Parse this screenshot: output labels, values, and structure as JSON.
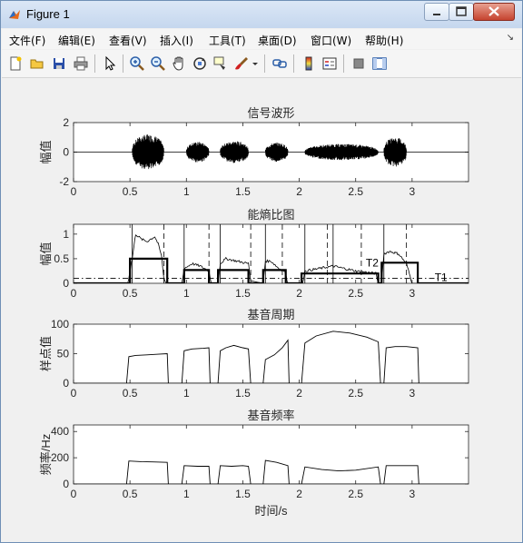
{
  "window": {
    "title": "Figure 1"
  },
  "menu": {
    "items": [
      "文件(F)",
      "编辑(E)",
      "查看(V)",
      "插入(I)",
      "工具(T)",
      "桌面(D)",
      "窗口(W)",
      "帮助(H)"
    ]
  },
  "toolbar": {
    "icons": [
      "new-figure-icon",
      "open-file-icon",
      "save-icon",
      "print-icon",
      "select-arrow-icon",
      "zoom-in-icon",
      "zoom-out-icon",
      "pan-hand-icon",
      "rotate-3d-icon",
      "data-cursor-icon",
      "brush-icon",
      "brush-dropdown-icon",
      "link-plot-icon",
      "colorbar-icon",
      "legend-icon",
      "hide-plot-tools-icon",
      "show-plot-tools-icon"
    ]
  },
  "colors": {
    "line": "#000000",
    "axes_bg": "#ffffff",
    "figure_bg": "#f0f0f0"
  },
  "chart_data": [
    {
      "type": "line",
      "title": "信号波形",
      "xlabel": "",
      "ylabel": "幅值",
      "xlim": [
        0,
        3.5
      ],
      "ylim": [
        -2,
        2
      ],
      "xticks": [
        "0",
        "0.5",
        "1",
        "1.5",
        "2",
        "2.5",
        "3"
      ],
      "yticks": [
        "-2",
        "0",
        "2"
      ],
      "segments": [
        {
          "start": 0.52,
          "end": 0.8,
          "amp": 1.2
        },
        {
          "start": 1.0,
          "end": 1.2,
          "amp": 0.7
        },
        {
          "start": 1.3,
          "end": 1.55,
          "amp": 0.75
        },
        {
          "start": 1.7,
          "end": 1.9,
          "amp": 0.65
        },
        {
          "start": 2.05,
          "end": 2.7,
          "amp": 0.55
        },
        {
          "start": 2.75,
          "end": 2.95,
          "amp": 1.0
        }
      ]
    },
    {
      "type": "line",
      "title": "能熵比图",
      "xlabel": "",
      "ylabel": "幅值",
      "xlim": [
        0,
        3.5
      ],
      "ylim": [
        0,
        1.2
      ],
      "xticks": [
        "0",
        "0.5",
        "1",
        "1.5",
        "2",
        "2.5",
        "3"
      ],
      "yticks": [
        "0",
        "0.5",
        "1"
      ],
      "annotations": [
        "T2",
        "T1"
      ],
      "threshold_T1": 0.1,
      "threshold_T2": 0.4,
      "solid_markers": [
        0.52,
        0.98,
        1.3,
        1.7,
        2.05,
        2.3,
        2.75
      ],
      "dashed_markers": [
        0.8,
        1.2,
        1.57,
        1.85,
        2.25,
        2.55,
        2.95
      ],
      "curve": [
        [
          0,
          0
        ],
        [
          0.48,
          0
        ],
        [
          0.52,
          0.5
        ],
        [
          0.55,
          1.0
        ],
        [
          0.6,
          0.9
        ],
        [
          0.65,
          0.85
        ],
        [
          0.72,
          0.95
        ],
        [
          0.75,
          0.8
        ],
        [
          0.78,
          0.55
        ],
        [
          0.8,
          0.1
        ],
        [
          0.82,
          0
        ],
        [
          0.96,
          0
        ],
        [
          0.98,
          0.3
        ],
        [
          1.05,
          0.4
        ],
        [
          1.12,
          0.35
        ],
        [
          1.2,
          0.25
        ],
        [
          1.22,
          0
        ],
        [
          1.28,
          0
        ],
        [
          1.3,
          0.4
        ],
        [
          1.35,
          0.5
        ],
        [
          1.45,
          0.45
        ],
        [
          1.55,
          0.4
        ],
        [
          1.57,
          0.05
        ],
        [
          1.68,
          0
        ],
        [
          1.7,
          0.45
        ],
        [
          1.75,
          0.45
        ],
        [
          1.82,
          0.3
        ],
        [
          1.87,
          0.25
        ],
        [
          1.9,
          0
        ],
        [
          2.03,
          0
        ],
        [
          2.05,
          0.25
        ],
        [
          2.3,
          0.35
        ],
        [
          2.5,
          0.25
        ],
        [
          2.68,
          0.2
        ],
        [
          2.7,
          0
        ],
        [
          2.73,
          0
        ],
        [
          2.75,
          0.6
        ],
        [
          2.8,
          0.65
        ],
        [
          2.88,
          0.6
        ],
        [
          2.95,
          0.4
        ],
        [
          3.0,
          0
        ],
        [
          3.5,
          0
        ]
      ],
      "step": [
        [
          0,
          0
        ],
        [
          0.5,
          0
        ],
        [
          0.5,
          0.5
        ],
        [
          0.83,
          0.5
        ],
        [
          0.83,
          0
        ],
        [
          0.98,
          0
        ],
        [
          0.98,
          0.27
        ],
        [
          1.2,
          0.27
        ],
        [
          1.2,
          0
        ],
        [
          1.28,
          0
        ],
        [
          1.28,
          0.27
        ],
        [
          1.55,
          0.27
        ],
        [
          1.55,
          0
        ],
        [
          1.68,
          0
        ],
        [
          1.68,
          0.27
        ],
        [
          1.88,
          0.27
        ],
        [
          1.88,
          0
        ],
        [
          2.02,
          0
        ],
        [
          2.02,
          0.2
        ],
        [
          2.7,
          0.2
        ],
        [
          2.7,
          0
        ],
        [
          2.73,
          0
        ],
        [
          2.73,
          0.42
        ],
        [
          3.05,
          0.42
        ],
        [
          3.05,
          0
        ],
        [
          3.5,
          0
        ]
      ]
    },
    {
      "type": "line",
      "title": "基音周期",
      "xlabel": "",
      "ylabel": "样点值",
      "xlim": [
        0,
        3.5
      ],
      "ylim": [
        0,
        100
      ],
      "xticks": [
        "0",
        "0.5",
        "1",
        "1.5",
        "2",
        "2.5",
        "3"
      ],
      "yticks": [
        "0",
        "50",
        "100"
      ],
      "segments": [
        [
          [
            0.47,
            0
          ],
          [
            0.49,
            45
          ],
          [
            0.55,
            47
          ],
          [
            0.65,
            48
          ],
          [
            0.75,
            49
          ],
          [
            0.83,
            50
          ],
          [
            0.84,
            0
          ]
        ],
        [
          [
            0.96,
            0
          ],
          [
            0.98,
            55
          ],
          [
            1.05,
            58
          ],
          [
            1.15,
            59
          ],
          [
            1.2,
            60
          ],
          [
            1.21,
            0
          ]
        ],
        [
          [
            1.28,
            0
          ],
          [
            1.3,
            55
          ],
          [
            1.35,
            60
          ],
          [
            1.42,
            64
          ],
          [
            1.5,
            60
          ],
          [
            1.55,
            58
          ],
          [
            1.57,
            0
          ]
        ],
        [
          [
            1.68,
            0
          ],
          [
            1.7,
            40
          ],
          [
            1.78,
            48
          ],
          [
            1.85,
            60
          ],
          [
            1.9,
            73
          ],
          [
            1.91,
            0
          ]
        ],
        [
          [
            2.02,
            0
          ],
          [
            2.05,
            68
          ],
          [
            2.15,
            80
          ],
          [
            2.3,
            88
          ],
          [
            2.45,
            85
          ],
          [
            2.6,
            78
          ],
          [
            2.7,
            70
          ],
          [
            2.72,
            0
          ]
        ],
        [
          [
            2.75,
            0
          ],
          [
            2.77,
            60
          ],
          [
            2.85,
            62
          ],
          [
            2.95,
            62
          ],
          [
            3.05,
            60
          ],
          [
            3.06,
            0
          ]
        ]
      ]
    },
    {
      "type": "line",
      "title": "基音频率",
      "xlabel": "时间/s",
      "ylabel": "频率/Hz",
      "xlim": [
        0,
        3.5
      ],
      "ylim": [
        0,
        450
      ],
      "xticks": [
        "0",
        "0.5",
        "1",
        "1.5",
        "2",
        "2.5",
        "3"
      ],
      "yticks": [
        "0",
        "200",
        "400"
      ],
      "segments": [
        [
          [
            0.47,
            0
          ],
          [
            0.49,
            175
          ],
          [
            0.6,
            170
          ],
          [
            0.7,
            168
          ],
          [
            0.83,
            165
          ],
          [
            0.84,
            0
          ]
        ],
        [
          [
            0.96,
            0
          ],
          [
            0.98,
            140
          ],
          [
            1.1,
            135
          ],
          [
            1.2,
            135
          ],
          [
            1.21,
            0
          ]
        ],
        [
          [
            1.28,
            0
          ],
          [
            1.3,
            140
          ],
          [
            1.4,
            135
          ],
          [
            1.5,
            140
          ],
          [
            1.55,
            135
          ],
          [
            1.57,
            0
          ]
        ],
        [
          [
            1.68,
            0
          ],
          [
            1.7,
            180
          ],
          [
            1.8,
            165
          ],
          [
            1.9,
            140
          ],
          [
            1.91,
            0
          ]
        ],
        [
          [
            2.02,
            0
          ],
          [
            2.05,
            130
          ],
          [
            2.2,
            110
          ],
          [
            2.35,
            100
          ],
          [
            2.5,
            105
          ],
          [
            2.7,
            130
          ],
          [
            2.72,
            0
          ]
        ],
        [
          [
            2.75,
            0
          ],
          [
            2.77,
            140
          ],
          [
            2.9,
            140
          ],
          [
            3.05,
            140
          ],
          [
            3.06,
            0
          ]
        ]
      ]
    }
  ]
}
